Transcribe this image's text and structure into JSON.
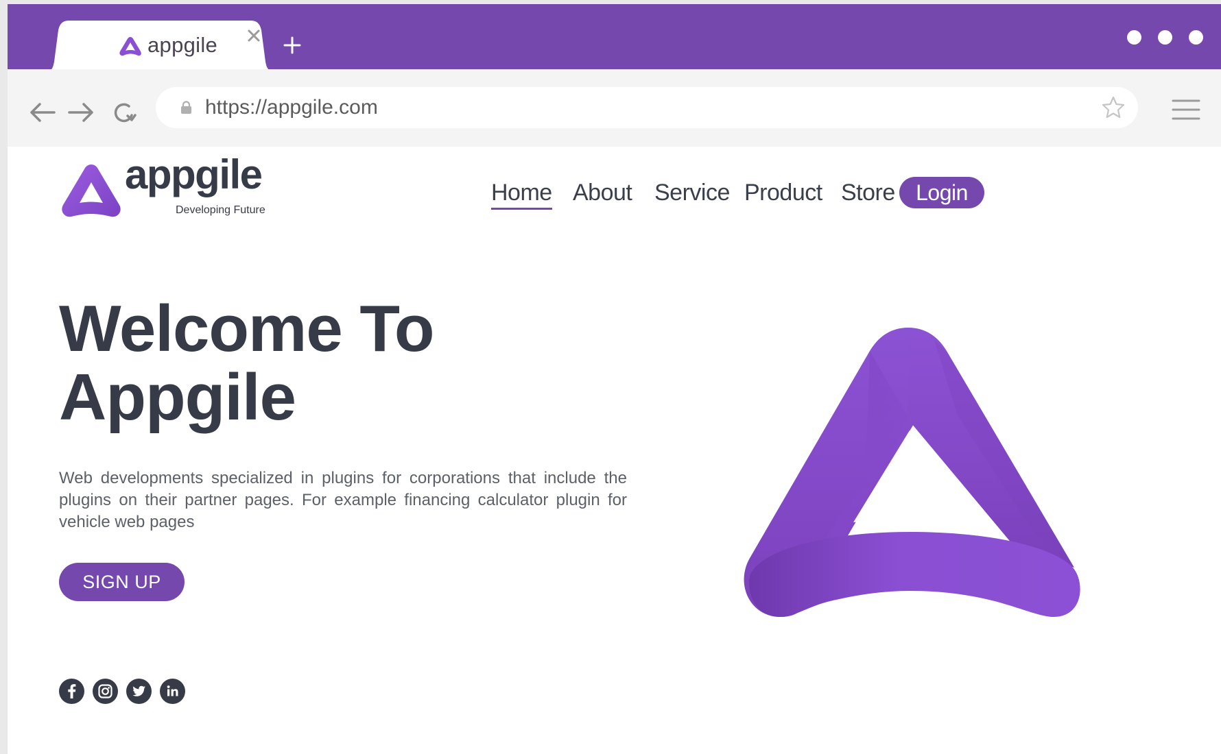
{
  "browser": {
    "tab": {
      "title": "appgile"
    },
    "address_bar": {
      "url": "https://appgile.com"
    }
  },
  "site": {
    "brand": {
      "name": "appgile",
      "tagline": "Developing Future"
    },
    "nav": {
      "items": [
        {
          "label": "Home",
          "active": true
        },
        {
          "label": "About"
        },
        {
          "label": "Service"
        },
        {
          "label": "Product"
        },
        {
          "label": "Store"
        }
      ],
      "login_label": "Login"
    },
    "hero": {
      "title_line1": "Welcome To",
      "title_line2": "Appgile",
      "description": "Web developments specialized in plugins for corporations that include the plugins on their partner pages. For example financing calculator plugin for vehicle web pages",
      "signup_label": "SIGN UP"
    },
    "social": [
      "facebook-icon",
      "instagram-icon",
      "twitter-icon",
      "linkedin-icon"
    ]
  },
  "colors": {
    "tab_strip": "#7448ad",
    "brand_purple": "#8a4fd3",
    "text_dark": "#363b47",
    "button": "#7448ad"
  }
}
